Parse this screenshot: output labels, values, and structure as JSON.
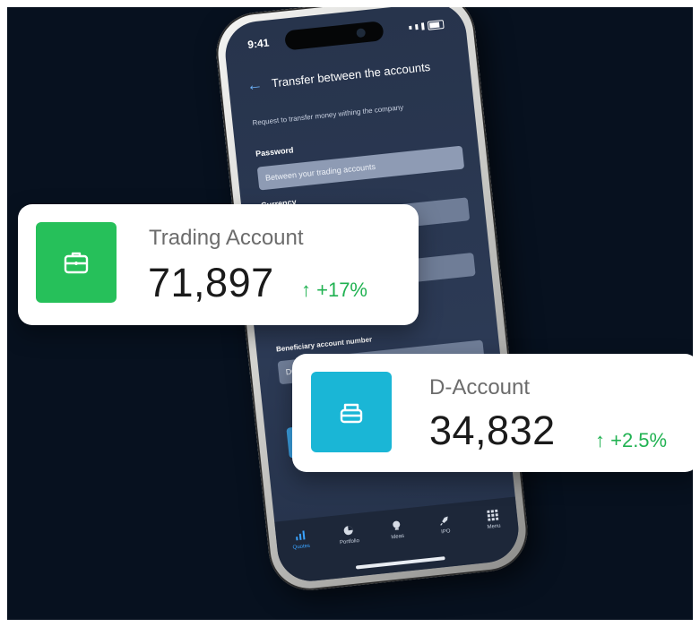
{
  "phone": {
    "status_time": "9:41",
    "screen_title": "Transfer between the accounts",
    "subtitle": "Request to transfer money withing the company",
    "fields": [
      {
        "label": "Password",
        "value": "Between your trading accounts"
      },
      {
        "label": "Currency",
        "value": ""
      },
      {
        "label": "Beneficiary account number",
        "value": "D00000"
      }
    ],
    "tabs": [
      {
        "label": "Quotes",
        "icon": "bar-chart-icon",
        "active": true
      },
      {
        "label": "Portfolio",
        "icon": "pie-chart-icon",
        "active": false
      },
      {
        "label": "Ideas",
        "icon": "lightbulb-icon",
        "active": false
      },
      {
        "label": "IPO",
        "icon": "rocket-icon",
        "active": false
      },
      {
        "label": "Menu",
        "icon": "grid-icon",
        "active": false
      }
    ]
  },
  "cards": {
    "trading": {
      "title": "Trading Account",
      "value": "71,897",
      "change": "↑ +17%",
      "icon": "briefcase-icon",
      "color": "#26c05a"
    },
    "d_account": {
      "title": "D-Account",
      "value": "34,832",
      "change": "↑ +2.5%",
      "icon": "wallet-icon",
      "color": "#1ab6d6"
    }
  },
  "colors": {
    "background": "#07111f",
    "positive": "#21b252",
    "accent": "#3aa3ff"
  }
}
